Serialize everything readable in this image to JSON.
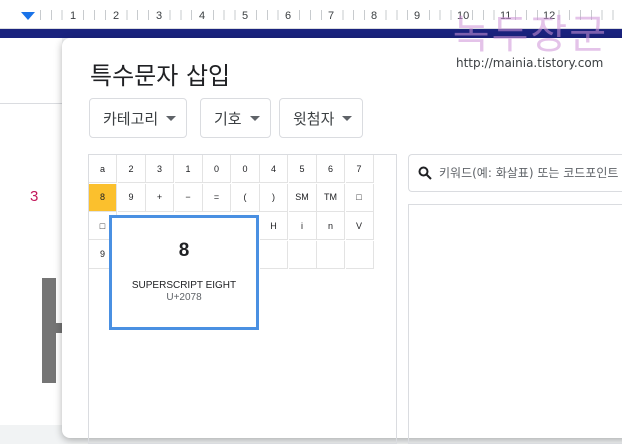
{
  "ruler": {
    "numbers": [
      "1",
      "2",
      "3",
      "4",
      "5",
      "6",
      "7",
      "8",
      "9",
      "10",
      "11",
      "12"
    ]
  },
  "document": {
    "page_number": "3"
  },
  "dialog": {
    "title": "특수문자 삽입",
    "dropdowns": {
      "category": "카테고리",
      "symbol": "기호",
      "superscript": "윗첨자"
    },
    "search": {
      "placeholder": "키워드(예: 화살표) 또는 코드포인트"
    }
  },
  "grid": {
    "rows": [
      [
        "a",
        "2",
        "3",
        "1",
        "0",
        "0",
        "4",
        "5",
        "6",
        "7"
      ],
      [
        "8",
        "9",
        "+",
        "−",
        "=",
        "(",
        ")",
        "SM",
        "TM",
        "□"
      ],
      [
        "□",
        "",
        "",
        "",
        "",
        "",
        "H",
        "i",
        "n",
        "V"
      ],
      [
        "9",
        "",
        "",
        "",
        "",
        "",
        "",
        "",
        "",
        ""
      ]
    ],
    "selected": "8"
  },
  "preview": {
    "glyph": "8",
    "name": "SUPERSCRIPT EIGHT",
    "code": "U+2078"
  },
  "watermark": {
    "text": "녹두장군",
    "url": "http://mainia.tistory.com"
  },
  "colors": {
    "accent": "#1a73e8",
    "selected": "#fbc02d",
    "preview_border": "#4a90e2"
  }
}
